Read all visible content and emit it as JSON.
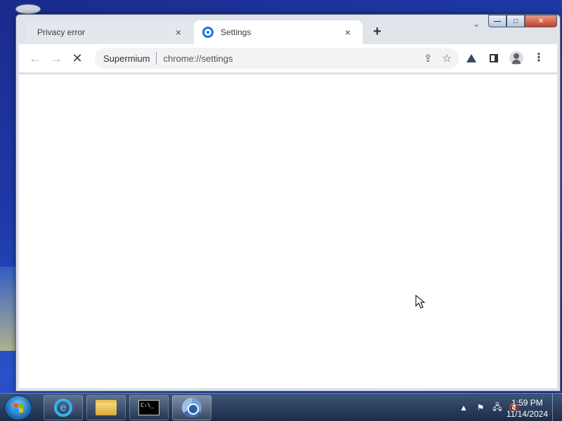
{
  "tabs": [
    {
      "title": "Privacy error",
      "close": "×"
    },
    {
      "title": "Settings",
      "close": "×"
    }
  ],
  "new_tab_label": "+",
  "toolbar": {
    "back_icon": "←",
    "forward_icon": "→",
    "stop_icon": "✕"
  },
  "omnibox": {
    "site_label": "Supermium",
    "url": "chrome://settings"
  },
  "window_controls": {
    "minimize": "—",
    "maximize": "□",
    "close": "✕",
    "tab_search": "⌄"
  },
  "taskbar": {
    "apps": [
      "internet-explorer",
      "windows-explorer",
      "command-prompt",
      "supermium-browser"
    ],
    "cmd_text": "C:\\_",
    "ie_glyph": "e"
  },
  "tray": {
    "show_hidden": "▲",
    "flag_icon": "⚑",
    "network_icon": "🖧",
    "volume_icon": "🔇"
  },
  "clock": {
    "time": "1:59 PM",
    "date": "11/14/2024"
  },
  "colors": {
    "accent": "#1a73e8",
    "desktop": "#1e3aa8",
    "taskbar": "#1b2c47"
  }
}
